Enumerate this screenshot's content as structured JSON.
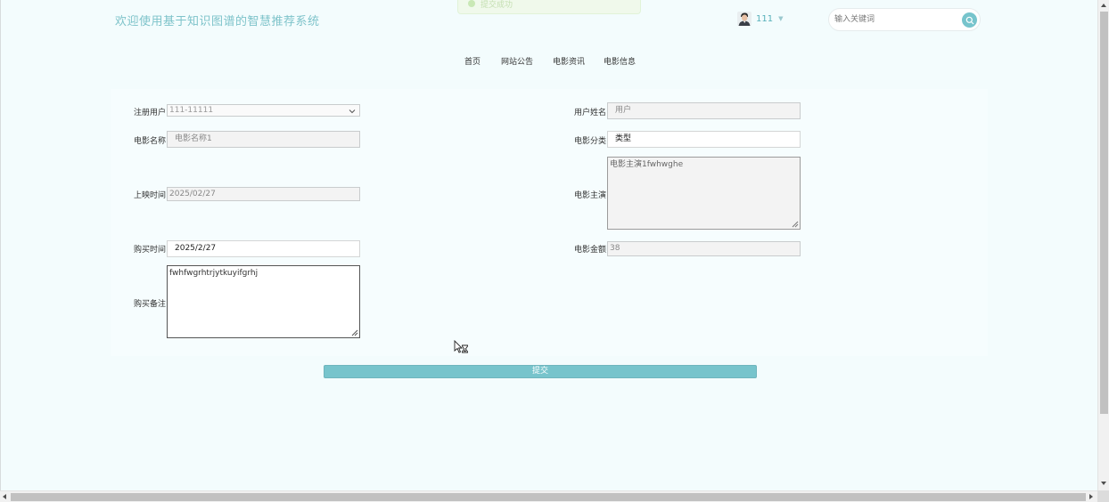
{
  "header": {
    "site_title": "欢迎使用基于知识图谱的智慧推荐系统",
    "toast_message": "提交成功",
    "username": "111",
    "search_placeholder": "输入关键词",
    "accent_color": "#77c4cc"
  },
  "nav": {
    "items": [
      {
        "label": "首页"
      },
      {
        "label": "网站公告"
      },
      {
        "label": "电影资讯"
      },
      {
        "label": "电影信息"
      }
    ]
  },
  "form": {
    "registered_user": {
      "label": "注册用户:",
      "value": "111-11111"
    },
    "user_name": {
      "label": "用户姓名:",
      "value": "用户"
    },
    "movie_name": {
      "label": "电影名称:",
      "value": "电影名称1"
    },
    "movie_category": {
      "label": "电影分类:",
      "value": "类型"
    },
    "release_date": {
      "label": "上映时间:",
      "value": "2025/02/27"
    },
    "movie_cast": {
      "label": "电影主演:",
      "value": "电影主演1fwhwghe"
    },
    "purchase_date": {
      "label": "购买时间:",
      "value": "2025/2/27"
    },
    "movie_price": {
      "label": "电影金额:",
      "value": "38"
    },
    "purchase_note": {
      "label": "购买备注:",
      "value": "fwhfwgrhtrjytkuyifgrhj"
    },
    "submit_label": "提交"
  }
}
